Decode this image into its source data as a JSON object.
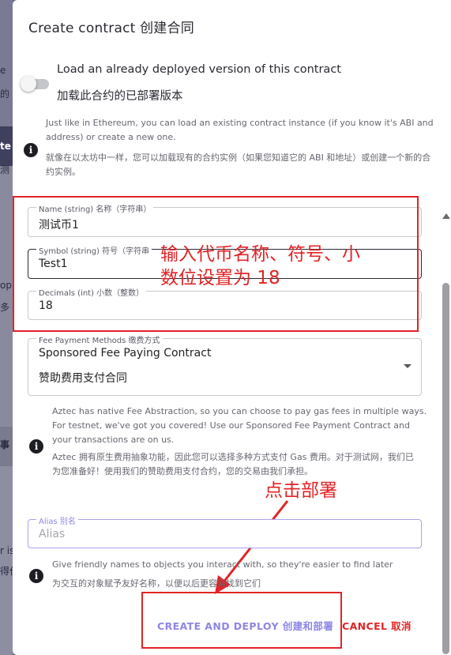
{
  "background": {
    "side_texts": [
      "e",
      "的",
      "te",
      "测",
      "op",
      "多",
      "事",
      "r is",
      "得价"
    ]
  },
  "dialog": {
    "title": "Create contract  创建合同",
    "toggle": {
      "state": "off",
      "label_en": "Load an already deployed version of this contract",
      "label_zh": "加载此合约的已部署版本"
    },
    "load_help": {
      "en_line1": "Just like in Ethereum, you can load an existing contract instance (if you know it's ABI and",
      "en_line2": "address) or create a new one.",
      "zh_line1": "就像在以太坊中一样，您可以加载现有的合约实例（如果您知道它的 ABI 和地址）或创建一个新的合",
      "zh_line2": "约实例。"
    },
    "fields": {
      "name": {
        "label": "Name (string)  名称（字符串）",
        "value": "测试币1"
      },
      "symbol": {
        "label": "Symbol (string)  符号（字符串",
        "value": "Test1"
      },
      "decimals": {
        "label": "Decimals (int)  小数（整数）",
        "value": "18"
      },
      "fee": {
        "label": "Fee Payment Methods  缴费方式",
        "value_en": "Sponsored Fee Paying Contract",
        "value_zh": "赞助费用支付合同"
      },
      "alias": {
        "label": "Alias  别名",
        "placeholder": "Alias"
      }
    },
    "fee_help": {
      "en_line1": "Aztec has native Fee Abstraction, so you can choose to pay gas fees in multiple ways.",
      "en_line2": "For testnet, we've got you covered! Use our Sponsored Fee Payment Contract and",
      "en_line3": "your transactions are on us.",
      "zh_line1": "Aztec 拥有原生费用抽象功能，因此您可以选择多种方式支付 Gas 费用。对于测试网，我们已",
      "zh_line2": "为您准备好！使用我们的赞助费用支付合约，您的交易由我们承担。"
    },
    "alias_help": {
      "en": "Give friendly names to objects you interact with, so they're easier to find later",
      "zh": "为交互的对象赋予友好名称，以便以后更容易找到它们"
    },
    "buttons": {
      "create": "CREATE AND DEPLOY  创建和部署",
      "cancel": "CANCEL  取消"
    }
  },
  "annotations": {
    "fields_note_line1": "输入代币名称、符号、小",
    "fields_note_line2": "数位设置为 18",
    "click_note": "点击部署"
  },
  "colors": {
    "accent": "#8d86e6",
    "annotation_red": "#e32326",
    "alias_border": "#a9a3ea"
  }
}
